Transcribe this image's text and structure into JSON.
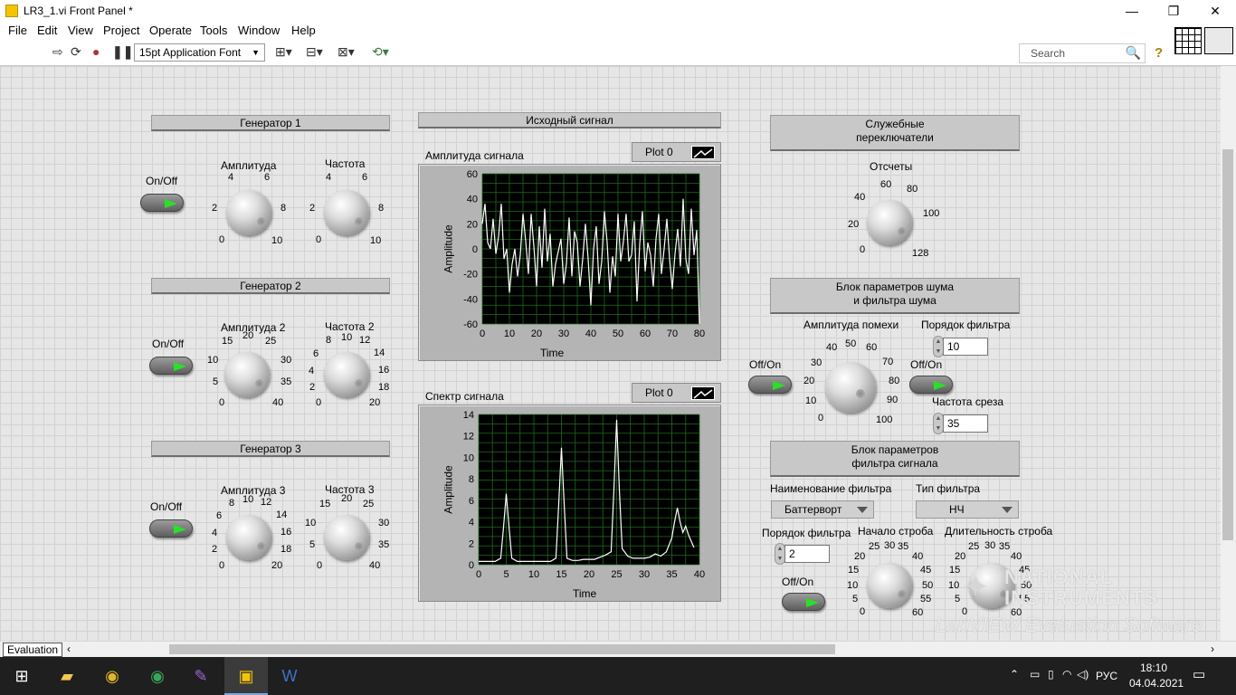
{
  "window": {
    "title": "LR3_1.vi Front Panel *",
    "minimize": "—",
    "restore": "❐",
    "close": "✕"
  },
  "menu": [
    "File",
    "Edit",
    "View",
    "Project",
    "Operate",
    "Tools",
    "Window",
    "Help"
  ],
  "toolbar": {
    "font": "15pt Application Font",
    "search_placeholder": "Search",
    "help": "?"
  },
  "generators": [
    {
      "title": "Генератор 1",
      "switch_label": "On/Off",
      "amp_label": "Амплитуда",
      "freq_label": "Частота",
      "amp_ticks": [
        "0",
        "2",
        "4",
        "6",
        "8",
        "10"
      ],
      "freq_ticks": [
        "0",
        "2",
        "4",
        "6",
        "8",
        "10"
      ]
    },
    {
      "title": "Генератор 2",
      "switch_label": "On/Off",
      "amp_label": "Амплитуда 2",
      "freq_label": "Частота 2",
      "amp_ticks": [
        "0",
        "5",
        "10",
        "15",
        "20",
        "25",
        "30",
        "35",
        "40"
      ],
      "freq_ticks": [
        "0",
        "2",
        "4",
        "6",
        "8",
        "10",
        "12",
        "14",
        "16",
        "18",
        "20"
      ]
    },
    {
      "title": "Генератор 3",
      "switch_label": "On/Off",
      "amp_label": "Амплитуда 3",
      "freq_label": "Частота 3",
      "amp_ticks": [
        "0",
        "2",
        "4",
        "6",
        "8",
        "10",
        "12",
        "14",
        "16",
        "18",
        "20"
      ],
      "freq_ticks": [
        "0",
        "5",
        "10",
        "15",
        "20",
        "25",
        "30",
        "35",
        "40"
      ]
    }
  ],
  "graph1": {
    "section": "Исходный сигнал",
    "title": "Амплитуда сигнала",
    "legend": "Plot 0",
    "xlabel": "Time",
    "ylabel": "Amplitude",
    "yticks": [
      "60",
      "40",
      "20",
      "0",
      "-20",
      "-40",
      "-60"
    ],
    "xticks": [
      "0",
      "10",
      "20",
      "30",
      "40",
      "50",
      "60",
      "70",
      "80"
    ]
  },
  "graph2": {
    "title": "Спектр сигнала",
    "legend": "Plot 0",
    "xlabel": "Time",
    "ylabel": "Amplitude",
    "yticks": [
      "14",
      "12",
      "10",
      "8",
      "6",
      "4",
      "2",
      "0"
    ],
    "xticks": [
      "0",
      "5",
      "10",
      "15",
      "20",
      "25",
      "30",
      "35",
      "40"
    ]
  },
  "chart_data": [
    {
      "type": "line",
      "title": "Амплитуда сигнала",
      "xlabel": "Time",
      "ylabel": "Amplitude",
      "xlim": [
        0,
        80
      ],
      "ylim": [
        -60,
        60
      ],
      "grid": true,
      "series": [
        {
          "name": "Plot 0",
          "values": [
            20,
            36,
            5,
            0,
            24,
            -4,
            10,
            36,
            -8,
            0,
            -35,
            -12,
            0,
            -22,
            -5,
            28,
            6,
            -20,
            28,
            2,
            -30,
            18,
            -15,
            32,
            -10,
            12,
            -30,
            -12,
            -2,
            8,
            -28,
            -12,
            25,
            -22,
            14,
            5,
            -30,
            -8,
            20,
            -8,
            -45,
            0,
            18,
            -28,
            -10,
            30,
            5,
            -35,
            -6,
            -22,
            28,
            -10,
            6,
            28,
            -10,
            -5,
            22,
            -42,
            4,
            30,
            -18,
            5,
            -5,
            -30,
            8,
            28,
            -20,
            0,
            24,
            -8,
            -32,
            -4,
            16,
            -14,
            40,
            -8,
            -20,
            32,
            -5,
            15,
            -60
          ]
        }
      ]
    },
    {
      "type": "line",
      "title": "Спектр сигнала",
      "xlabel": "Time",
      "ylabel": "Amplitude",
      "xlim": [
        0,
        40
      ],
      "ylim": [
        0,
        14
      ],
      "grid": true,
      "series": [
        {
          "name": "Plot 0",
          "x": [
            0,
            1,
            2,
            3,
            4,
            4.5,
            5,
            5.5,
            6,
            7,
            8,
            9,
            10,
            11,
            12,
            13,
            14,
            14.5,
            15,
            15.5,
            16,
            17,
            18,
            19,
            20,
            21,
            22,
            23,
            24,
            24.5,
            25,
            25.5,
            26,
            27,
            28,
            29,
            30,
            31,
            32,
            33,
            34,
            35,
            35.5,
            36,
            36.5,
            37,
            37.5,
            38,
            39
          ],
          "y": [
            0.3,
            0.3,
            0.3,
            0.3,
            0.6,
            3.5,
            6.6,
            3.5,
            0.6,
            0.3,
            0.3,
            0.3,
            0.3,
            0.3,
            0.3,
            0.3,
            0.6,
            5.5,
            10.9,
            5.5,
            0.6,
            0.4,
            0.4,
            0.5,
            0.5,
            0.5,
            0.7,
            0.9,
            1.2,
            7,
            13.5,
            7,
            1.5,
            0.8,
            0.6,
            0.6,
            0.6,
            0.7,
            1,
            0.8,
            1.2,
            2.5,
            4,
            5.3,
            4,
            3,
            3.6,
            2.8,
            1.6
          ]
        }
      ]
    }
  ],
  "service": {
    "title": "Служебные\nпереключатели",
    "knob_label": "Отсчеты",
    "ticks": [
      "0",
      "20",
      "40",
      "60",
      "80",
      "100",
      "128"
    ]
  },
  "noise": {
    "title": "Блок параметров шума\nи фильтра шума",
    "amp_label": "Амплитуда помехи",
    "amp_ticks": [
      "0",
      "10",
      "20",
      "30",
      "40",
      "50",
      "60",
      "70",
      "80",
      "90",
      "100"
    ],
    "switch1": "Off/On",
    "switch2": "Off/On",
    "order_label": "Порядок фильтра",
    "order_value": "10",
    "cutoff_label": "Частота среза",
    "cutoff_value": "35"
  },
  "filter": {
    "title": "Блок параметров\nфильтра сигнала",
    "name_label": "Наименование фильтра",
    "name_value": "Баттерворт",
    "type_label": "Тип фильтра",
    "type_value": "НЧ",
    "order_label": "Порядок фильтра",
    "order_value": "2",
    "switch": "Off/On",
    "strobe_start_label": "Начало строба",
    "strobe_len_label": "Длительность строба",
    "strobe_ticks": [
      "0",
      "5",
      "10",
      "15",
      "20",
      "25",
      "30",
      "35",
      "40",
      "45",
      "50",
      "55",
      "60"
    ]
  },
  "watermark": {
    "line1": "NATIONAL",
    "line2": "INSTRUMENTS",
    "line3": "LabVIEW Evaluation Software"
  },
  "statusbar": {
    "label": "Evaluation"
  },
  "taskbar": {
    "lang": "РУС",
    "time": "18:10",
    "date": "04.04.2021"
  }
}
